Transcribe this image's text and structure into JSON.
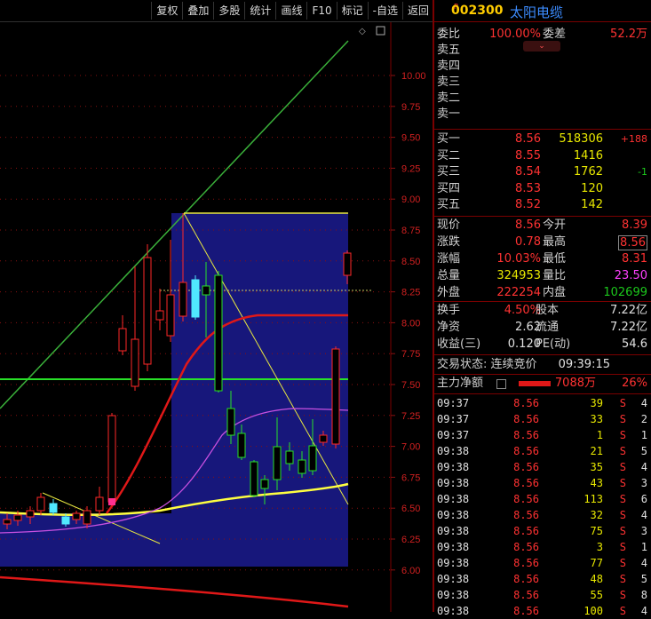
{
  "toolbar": [
    "复权",
    "叠加",
    "多股",
    "统计",
    "画线",
    "F10",
    "标记",
    "-自选",
    "返回"
  ],
  "y_axis": [
    "10.00",
    "9.75",
    "9.50",
    "9.25",
    "9.00",
    "8.75",
    "8.50",
    "8.25",
    "8.00",
    "7.75",
    "7.50",
    "7.25",
    "7.00",
    "6.75",
    "6.50",
    "6.25",
    "6.00"
  ],
  "stock": {
    "badge": "R",
    "code": "002300",
    "name": "太阳电缆"
  },
  "weibi": {
    "label": "委比",
    "value": "100.00%",
    "label2": "委差",
    "value2": "52.2万"
  },
  "sell": [
    {
      "label": "卖五"
    },
    {
      "label": "卖四"
    },
    {
      "label": "卖三"
    },
    {
      "label": "卖二"
    },
    {
      "label": "卖一"
    }
  ],
  "buy": [
    {
      "label": "买一",
      "price": "8.56",
      "vol": "518306",
      "chg": "+188"
    },
    {
      "label": "买二",
      "price": "8.55",
      "vol": "1416",
      "chg": ""
    },
    {
      "label": "买三",
      "price": "8.54",
      "vol": "1762",
      "chg": "-1"
    },
    {
      "label": "买四",
      "price": "8.53",
      "vol": "120",
      "chg": ""
    },
    {
      "label": "买五",
      "price": "8.52",
      "vol": "142",
      "chg": ""
    }
  ],
  "quote": [
    {
      "l1": "现价",
      "v1": "8.56",
      "l2": "今开",
      "v2": "8.39"
    },
    {
      "l1": "涨跌",
      "v1": "0.78",
      "l2": "最高",
      "v2": "8.56"
    },
    {
      "l1": "涨幅",
      "v1": "10.03%",
      "l2": "最低",
      "v2": "8.31"
    },
    {
      "l1": "总量",
      "v1": "324953",
      "l2": "量比",
      "v2": "23.50"
    },
    {
      "l1": "外盘",
      "v1": "222254",
      "l2": "内盘",
      "v2": "102699"
    }
  ],
  "fund": [
    {
      "l1": "换手",
      "v1": "4.50%",
      "l2": "股本",
      "v2": "7.22亿"
    },
    {
      "l1": "净资",
      "v1": "2.62",
      "l2": "流通",
      "v2": "7.22亿"
    },
    {
      "l1": "收益(三)",
      "v1": "0.120",
      "l2": "PE(动)",
      "v2": "54.6"
    }
  ],
  "status": {
    "text": "交易状态: 连续竞价",
    "time": "09:39:15"
  },
  "mainflow": {
    "label": "主力净额",
    "value": "7088万",
    "pct": "26%"
  },
  "ticks": [
    {
      "t": "09:37",
      "p": "8.56",
      "v": "39",
      "n": "S"
    },
    {
      "t": "09:37",
      "p": "8.56",
      "v": "33",
      "n": "S"
    },
    {
      "t": "09:37",
      "p": "8.56",
      "v": "1",
      "n": "S"
    },
    {
      "t": "09:38",
      "p": "8.56",
      "v": "21",
      "n": "S"
    },
    {
      "t": "09:38",
      "p": "8.56",
      "v": "35",
      "n": "S"
    },
    {
      "t": "09:38",
      "p": "8.56",
      "v": "43",
      "n": "S"
    },
    {
      "t": "09:38",
      "p": "8.56",
      "v": "113",
      "n": "S"
    },
    {
      "t": "09:38",
      "p": "8.56",
      "v": "32",
      "n": "S"
    },
    {
      "t": "09:38",
      "p": "8.56",
      "v": "75",
      "n": "S"
    },
    {
      "t": "09:38",
      "p": "8.56",
      "v": "3",
      "n": "S"
    },
    {
      "t": "09:38",
      "p": "8.56",
      "v": "77",
      "n": "S"
    },
    {
      "t": "09:38",
      "p": "8.56",
      "v": "48",
      "n": "S"
    },
    {
      "t": "09:38",
      "p": "8.56",
      "v": "55",
      "n": "S"
    },
    {
      "t": "09:38",
      "p": "8.56",
      "v": "100",
      "n": "S"
    }
  ],
  "tick_nums": [
    "4",
    "2",
    "1",
    "5",
    "4",
    "3",
    "6",
    "4",
    "3",
    "1",
    "4",
    "5",
    "8",
    "4"
  ]
}
